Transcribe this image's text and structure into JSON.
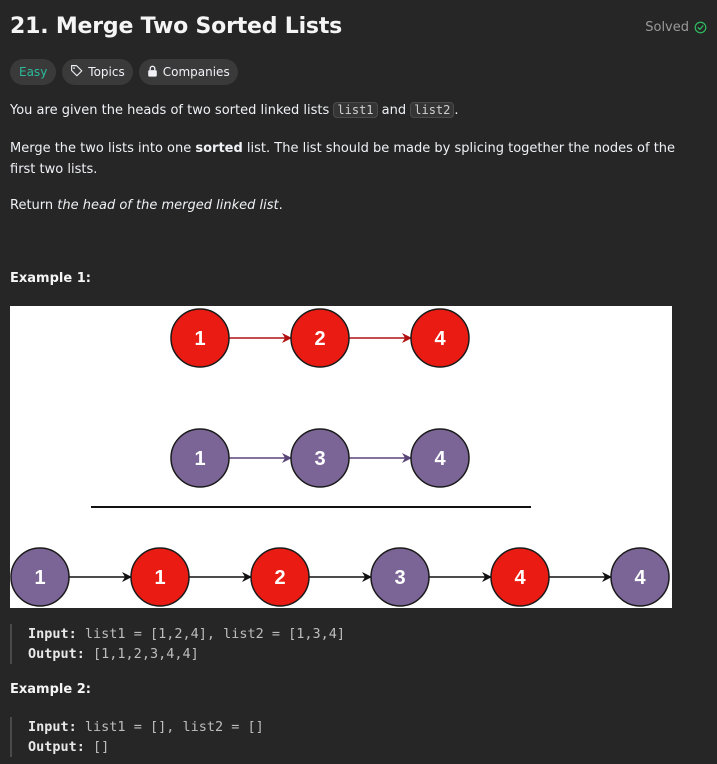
{
  "problem": {
    "title": "21. Merge Two Sorted Lists",
    "status": "Solved"
  },
  "tags": {
    "difficulty": "Easy",
    "topics": "Topics",
    "companies": "Companies"
  },
  "description": {
    "p1_before": "You are given the heads of two sorted linked lists ",
    "p1_code1": "list1",
    "p1_mid": " and ",
    "p1_code2": "list2",
    "p1_after": ".",
    "p2_before": "Merge the two lists into one ",
    "p2_bold": "sorted",
    "p2_after": " list. The list should be made by splicing together the nodes of the first two lists.",
    "p3_before": "Return ",
    "p3_italic": "the head of the merged linked list",
    "p3_after": "."
  },
  "example1": {
    "title": "Example 1:",
    "list1_nodes": [
      "1",
      "2",
      "4"
    ],
    "list2_nodes": [
      "1",
      "3",
      "4"
    ],
    "merged_nodes": [
      "1",
      "1",
      "2",
      "3",
      "4",
      "4"
    ],
    "input_label": "Input:",
    "input_value": "list1 = [1,2,4], list2 = [1,3,4]",
    "output_label": "Output:",
    "output_value": "[1,1,2,3,4,4]"
  },
  "example2": {
    "title": "Example 2:",
    "input_label": "Input:",
    "input_value": "list1 = [], list2 = []",
    "output_label": "Output:",
    "output_value": "[]"
  },
  "colors": {
    "red_node": "#e91b13",
    "purple_node": "#7b6597",
    "easy": "#2cbb9b",
    "solved_check": "#2cbb5d"
  }
}
